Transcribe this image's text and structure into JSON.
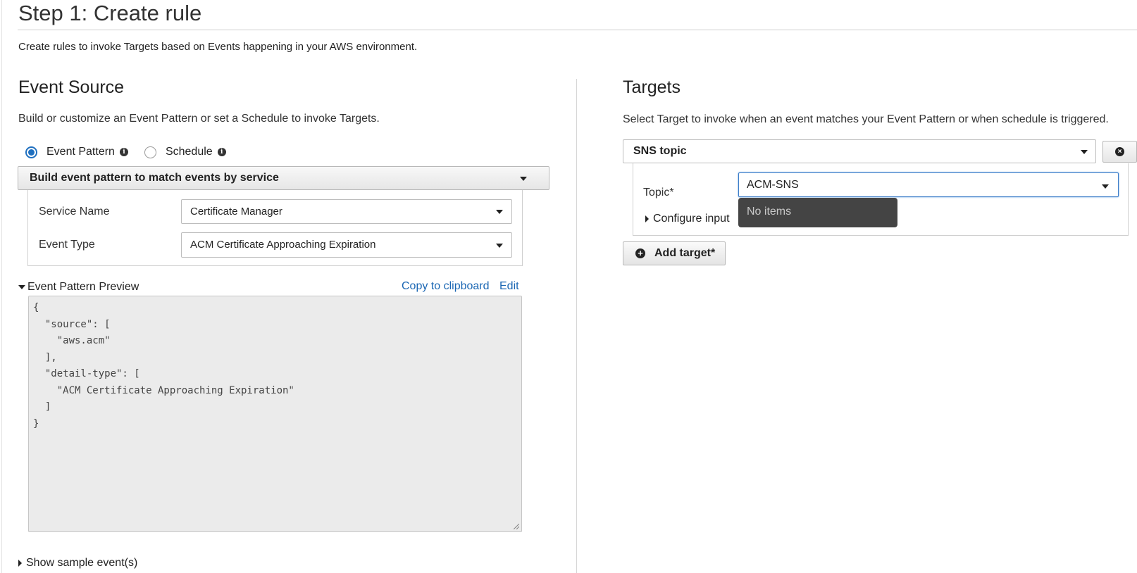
{
  "page": {
    "title": "Step 1: Create rule",
    "description": "Create rules to invoke Targets based on Events happening in your AWS environment."
  },
  "event_source": {
    "title": "Event Source",
    "description": "Build or customize an Event Pattern or set a Schedule to invoke Targets.",
    "options": [
      {
        "label": "Event Pattern",
        "selected": true
      },
      {
        "label": "Schedule",
        "selected": false
      }
    ],
    "build_mode": "Build event pattern to match events by service",
    "service_name_label": "Service Name",
    "service_name_value": "Certificate Manager",
    "event_type_label": "Event Type",
    "event_type_value": "ACM Certificate Approaching Expiration",
    "preview_label": "Event Pattern Preview",
    "copy_label": "Copy to clipboard",
    "edit_label": "Edit",
    "pattern_json": "{\n  \"source\": [\n    \"aws.acm\"\n  ],\n  \"detail-type\": [\n    \"ACM Certificate Approaching Expiration\"\n  ]\n}",
    "sample_events_label": "Show sample event(s)"
  },
  "targets": {
    "title": "Targets",
    "description": "Select Target to invoke when an event matches your Event Pattern or when schedule is triggered.",
    "target_type": "SNS topic",
    "topic_label": "Topic*",
    "topic_value": "ACM-SNS",
    "dropdown_message": "No items",
    "configure_input_label": "Configure input",
    "add_target_label": "Add target*"
  },
  "colors": {
    "accent": "#1f6fbf",
    "link": "#1a66b3",
    "dropdown_bg": "#444444"
  }
}
